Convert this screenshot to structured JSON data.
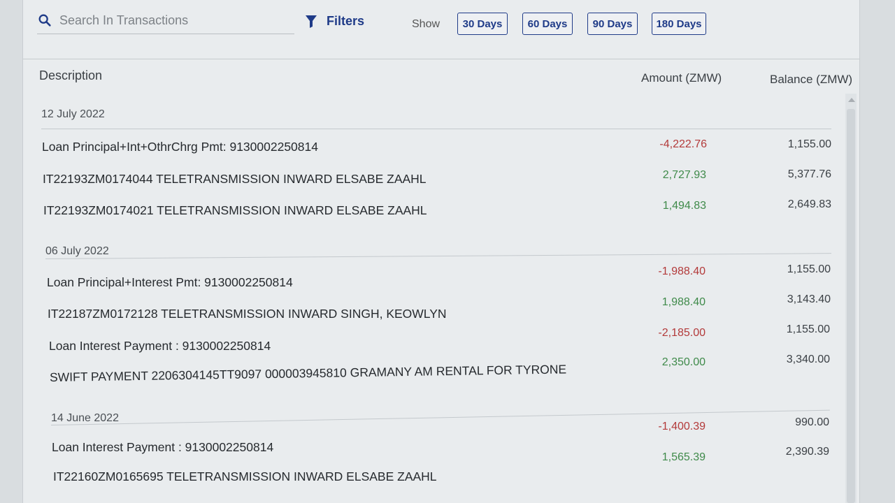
{
  "toolbar": {
    "search_placeholder": "Search In Transactions",
    "filters_label": "Filters",
    "show_label": "Show",
    "ranges": [
      "30 Days",
      "60 Days",
      "90 Days",
      "180 Days"
    ]
  },
  "table": {
    "headers": {
      "description": "Description",
      "amount": "Amount (ZMW)",
      "balance": "Balance (ZMW)"
    },
    "groups": [
      {
        "date": "12 July 2022",
        "rows": [
          {
            "description": "Loan Principal+Int+OthrChrg Pmt: 9130002250814",
            "amount": "-4,222.76",
            "balance": "1,155.00",
            "sign": "neg"
          },
          {
            "description": "IT22193ZM0174044 TELETRANSMISSION INWARD ELSABE ZAAHL",
            "amount": "2,727.93",
            "balance": "5,377.76",
            "sign": "pos"
          },
          {
            "description": "IT22193ZM0174021 TELETRANSMISSION INWARD ELSABE ZAAHL",
            "amount": "1,494.83",
            "balance": "2,649.83",
            "sign": "pos"
          }
        ]
      },
      {
        "date": "06 July 2022",
        "rows": [
          {
            "description": "Loan Principal+Interest Pmt: 9130002250814",
            "amount": "-1,988.40",
            "balance": "1,155.00",
            "sign": "neg"
          },
          {
            "description": "IT22187ZM0172128 TELETRANSMISSION INWARD SINGH, KEOWLYN",
            "amount": "1,988.40",
            "balance": "3,143.40",
            "sign": "pos"
          },
          {
            "description": "Loan Interest Payment : 9130002250814",
            "amount": "-2,185.00",
            "balance": "1,155.00",
            "sign": "neg"
          },
          {
            "description": "SWIFT PAYMENT 2206304145TT9097 000003945810 GRAMANY AM RENTAL FOR TYRONE",
            "amount": "2,350.00",
            "balance": "3,340.00",
            "sign": "pos"
          }
        ]
      },
      {
        "date": "14 June 2022",
        "rows": [
          {
            "description": "Loan Interest Payment : 9130002250814",
            "amount": "-1,400.39",
            "balance": "990.00",
            "sign": "neg"
          },
          {
            "description": "IT22160ZM0165695 TELETRANSMISSION INWARD ELSABE ZAAHL",
            "amount": "1,565.39",
            "balance": "2,390.39",
            "sign": "pos"
          }
        ]
      }
    ]
  },
  "colors": {
    "accent": "#1f3b88",
    "negative": "#b33a3a",
    "positive": "#3f8a4a"
  }
}
